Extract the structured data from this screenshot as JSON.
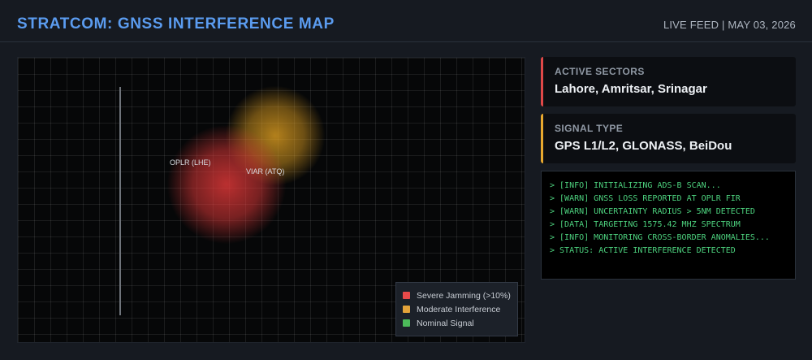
{
  "header": {
    "title": "STRATCOM: GNSS INTERFERENCE MAP",
    "feed": "LIVE FEED | MAY 03, 2026"
  },
  "map": {
    "sites": [
      {
        "label": "OPLR (LHE)"
      },
      {
        "label": "VIAR (ATQ)"
      }
    ],
    "zones": [
      {
        "type": "moderate",
        "color": "#eca822"
      },
      {
        "type": "severe",
        "color": "#e83a3a"
      }
    ],
    "legend": [
      {
        "label": "Severe Jamming (>10%)",
        "color": "#e84a4a"
      },
      {
        "label": "Moderate Interference",
        "color": "#e3a33a"
      },
      {
        "label": "Nominal Signal",
        "color": "#4cbb5a"
      }
    ]
  },
  "panels": {
    "sectors": {
      "label": "ACTIVE SECTORS",
      "value": "Lahore, Amritsar, Srinagar",
      "accent": "#e04848"
    },
    "signal": {
      "label": "SIGNAL TYPE",
      "value": "GPS L1/L2, GLONASS, BeiDou",
      "accent": "#e8a82e"
    }
  },
  "terminal": {
    "lines": [
      "> [INFO] INITIALIZING ADS-B SCAN...",
      "> [WARN] GNSS LOSS REPORTED AT OPLR FIR",
      "> [WARN] UNCERTAINTY RADIUS > 5NM DETECTED",
      "> [DATA] TARGETING 1575.42 MHZ SPECTRUM",
      "> [INFO] MONITORING CROSS-BORDER ANOMALIES...",
      "> STATUS: ACTIVE INTERFERENCE DETECTED"
    ]
  }
}
